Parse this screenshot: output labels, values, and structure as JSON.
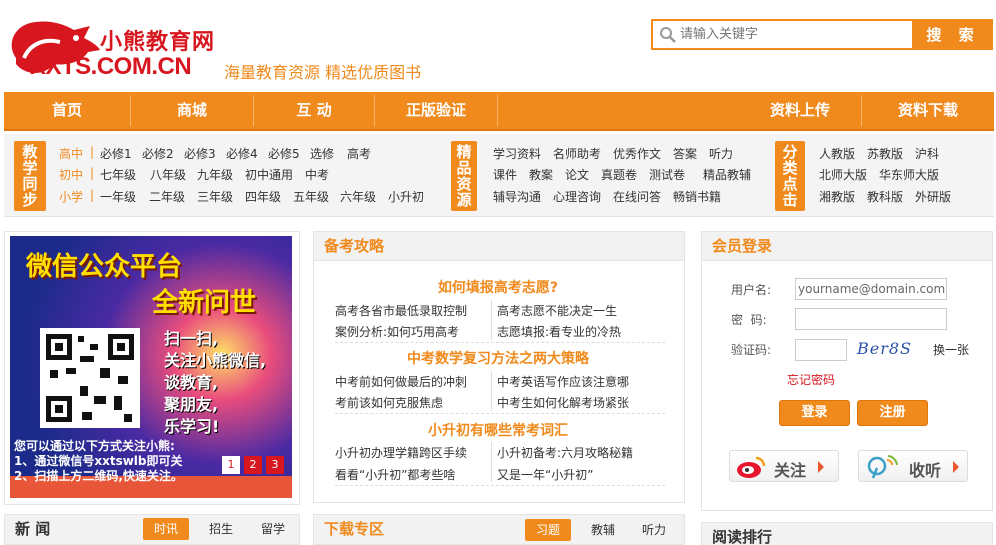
{
  "brand": {
    "name_cn": "小熊教育网",
    "url": "XXTS.COM.CN",
    "slogan": "海量教育资源 精选优质图书"
  },
  "search": {
    "placeholder": "请输入关键字",
    "button_label": "搜 索"
  },
  "nav": {
    "items": [
      "首页",
      "商城",
      "互 动",
      "正版验证",
      "资料上传",
      "资料下载"
    ]
  },
  "categories": {
    "study": {
      "tag": [
        "教",
        "学",
        "同",
        "步"
      ],
      "rows": [
        {
          "label": "高中",
          "links": [
            "必修1",
            "必修2",
            "必修3",
            "必修4",
            "必修5",
            "选修",
            "高考"
          ]
        },
        {
          "label": "初中",
          "links": [
            "七年级",
            "八年级",
            "九年级",
            "初中通用",
            "中考"
          ]
        },
        {
          "label": "小学",
          "links": [
            "一年级",
            "二年级",
            "三年级",
            "四年级",
            "五年级",
            "六年级",
            "小升初"
          ]
        }
      ]
    },
    "resources": {
      "tag": [
        "精",
        "品",
        "资",
        "源"
      ],
      "rows": [
        [
          "学习资料",
          "名师助考",
          "优秀作文",
          "答案",
          "听力"
        ],
        [
          "课件",
          "教案",
          "论文",
          "真题卷",
          "测试卷",
          "精品教辅"
        ],
        [
          "辅导沟通",
          "心理咨询",
          "在线问答",
          "畅销书籍"
        ]
      ]
    },
    "classify": {
      "tag": [
        "分",
        "类",
        "点",
        "击"
      ],
      "rows": [
        [
          "人教版",
          "苏教版",
          "沪科"
        ],
        [
          "北师大版",
          "华东师大版"
        ],
        [
          "湘教版",
          "教科版",
          "外研版"
        ]
      ]
    }
  },
  "banner": {
    "title1": "微信公众平台",
    "title2": "全新问世",
    "slogan_lines": [
      "扫一扫,",
      "关注小熊微信,",
      "谈教育,",
      "聚朋友,",
      "乐学习!"
    ],
    "caption1": "您可以通过以下方式关注小熊:",
    "caption2": "1、通过微信号xxtswlb即可关",
    "caption3": "2、扫描上方二维码,快速关注。",
    "pages": [
      "1",
      "2",
      "3"
    ]
  },
  "gaokao": {
    "title": "备考攻略",
    "sections": [
      {
        "heading": "如何填报高考志愿?",
        "links": [
          [
            "高考各省市最低录取控制",
            "高考志愿不能决定一生"
          ],
          [
            "案例分析:如何巧用高考",
            "志愿填报:看专业的冷热"
          ]
        ]
      },
      {
        "heading": "中考数学复习方法之两大策略",
        "links": [
          [
            "中考前如何做最后的冲刺",
            "中考英语写作应该注意哪"
          ],
          [
            "考前该如何克服焦虑",
            "中考生如何化解考场紧张"
          ]
        ]
      },
      {
        "heading": "小升初有哪些常考词汇",
        "links": [
          [
            "小升初办理学籍跨区手续",
            "小升初备考:六月攻略秘籍"
          ],
          [
            "看看“小升初”都考些啥",
            "又是一年“小升初”"
          ]
        ]
      }
    ]
  },
  "login": {
    "title": "会员登录",
    "username_label": "用户名:",
    "username_value": "yourname@domain.com",
    "password_label": "密  码:",
    "captcha_label": "验证码:",
    "captcha_text": "Ber8S",
    "refresh_label": "换一张",
    "forgot_label": "忘记密码",
    "login_btn": "登录",
    "register_btn": "注册",
    "follow_label": "关注",
    "listen_label": "收听"
  },
  "news": {
    "title": "新 闻",
    "tabs": [
      "时讯",
      "招生",
      "留学"
    ]
  },
  "downloads": {
    "title": "下载专区",
    "tabs": [
      "习题",
      "教辅",
      "听力"
    ]
  },
  "ranking": {
    "title": "阅读排行"
  },
  "colors": {
    "accent": "#f08a1c",
    "brand_red": "#d8161f",
    "nav_bg": "#f08a1c"
  }
}
